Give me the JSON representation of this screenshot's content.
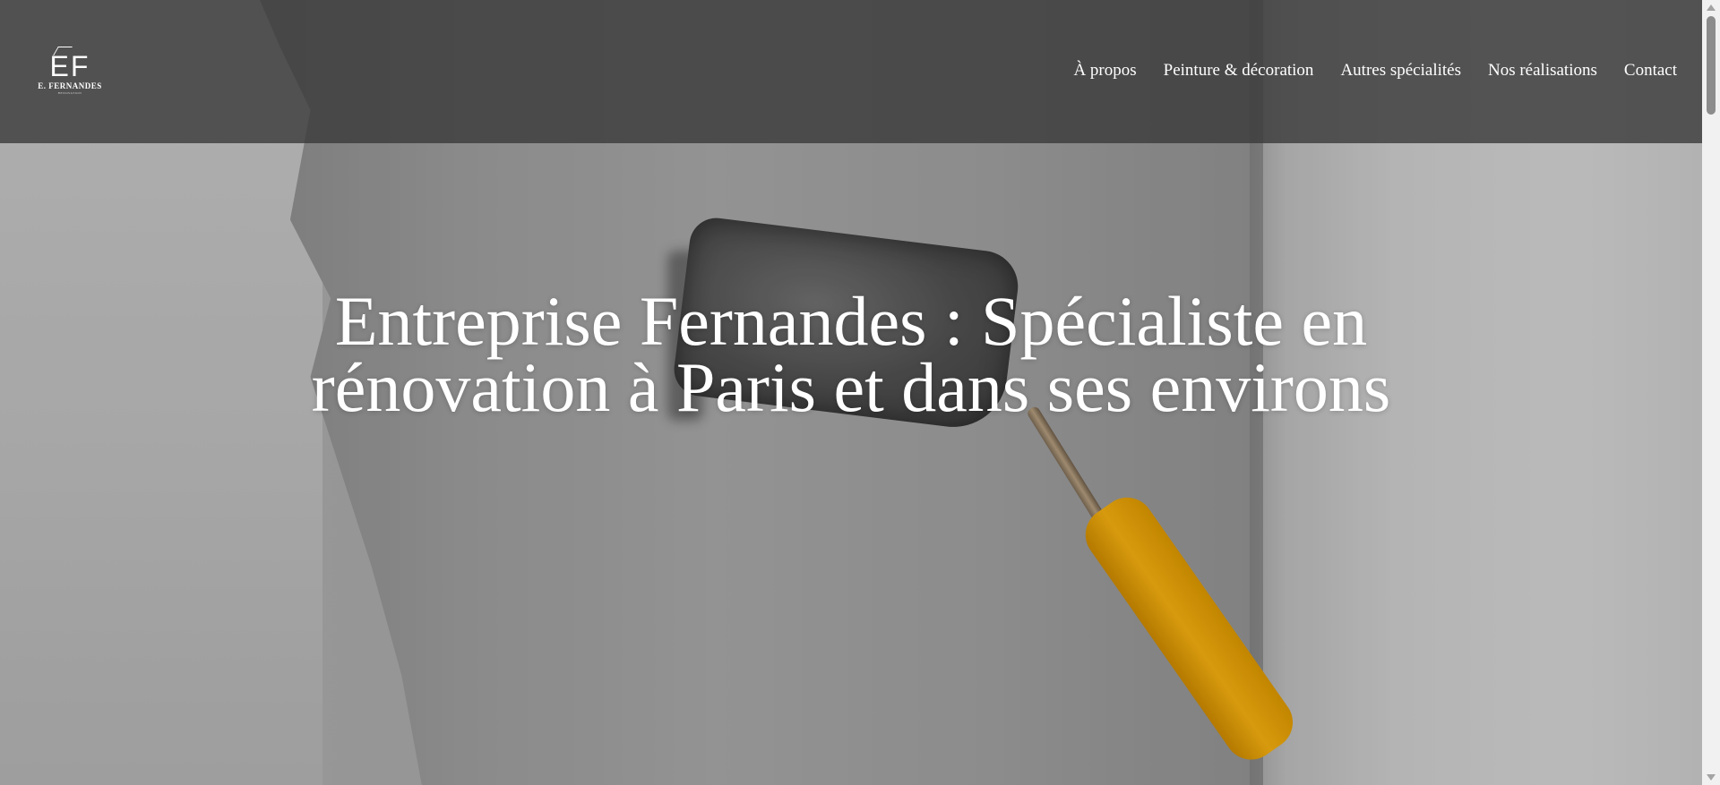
{
  "logo": {
    "mark": "EF",
    "name": "E. FERNANDES",
    "tagline": "RENOVATION"
  },
  "nav": {
    "items": [
      {
        "label": "À propos"
      },
      {
        "label": "Peinture & décoration"
      },
      {
        "label": "Autres spécialités"
      },
      {
        "label": "Nos réalisations"
      },
      {
        "label": "Contact"
      }
    ]
  },
  "hero": {
    "title": "Entreprise Fernandes : Spécialiste en rénovation à Paris et dans ses environs",
    "background": "paint-roller-on-wall-photo"
  },
  "colors": {
    "header_bg": "#3a3a3a",
    "text": "#ffffff",
    "roller_handle": "#f0ac10"
  }
}
